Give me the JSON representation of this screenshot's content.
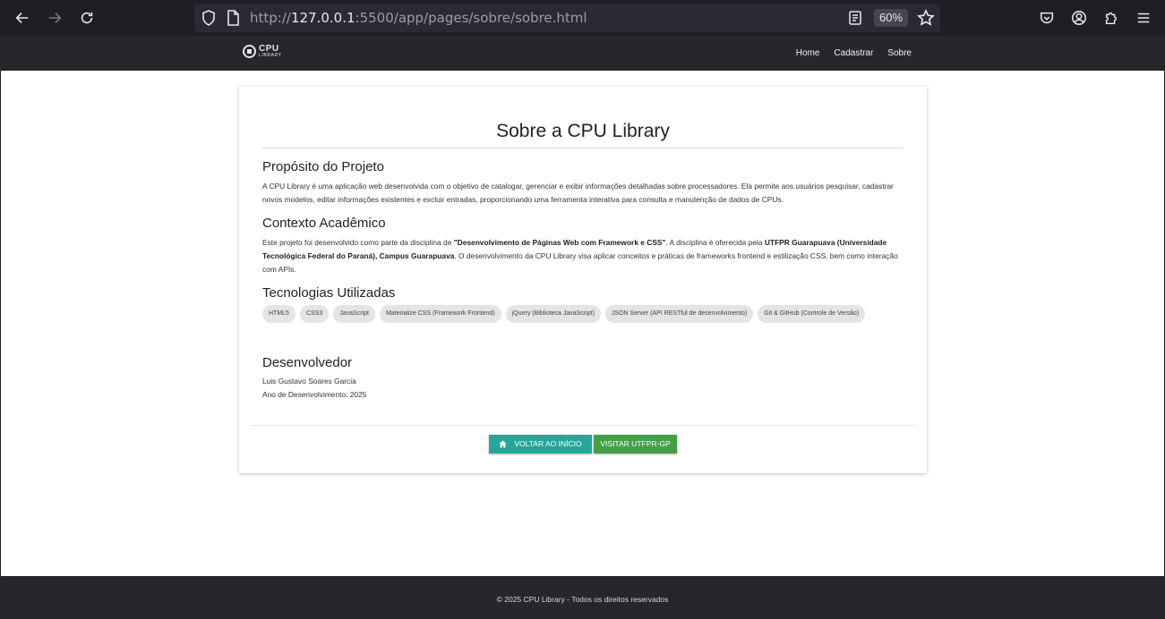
{
  "browser": {
    "url_prefix": "http://",
    "url_host": "127.0.0.1",
    "url_rest": ":5500/app/pages/sobre/sobre.html",
    "zoom": "60%"
  },
  "site": {
    "logo_line1": "CPU",
    "logo_line2": "LIBRARY",
    "nav": [
      "Home",
      "Cadastrar",
      "Sobre"
    ]
  },
  "card": {
    "title": "Sobre a CPU Library",
    "purpose_heading": "Propósito do Projeto",
    "purpose_text": "A CPU Library é uma aplicação web desenvolvida com o objetivo de catalogar, gerenciar e exibir informações detalhadas sobre processadores. Ela permite aos usuários pesquisar, cadastrar novos modelos, editar informações existentes e excluir entradas, proporcionando uma ferramenta interativa para consulta e manutenção de dados de CPUs.",
    "context_heading": "Contexto Acadêmico",
    "context_p1": "Este projeto foi desenvolvido como parte da disciplina de ",
    "context_b1": "\"Desenvolvimento de Páginas Web com Framework e CSS\"",
    "context_p2": ". A disciplina é oferecida pela ",
    "context_b2": "UTFPR Guarapuava (Universidade Tecnológica Federal do Paraná), Campus Guarapuava",
    "context_p3": ". O desenvolvimento da CPU Library visa aplicar conceitos e práticas de frameworks frontend e estilização CSS, bem como interação com APIs.",
    "tech_heading": "Tecnologias Utilizadas",
    "techs": [
      "HTML5",
      "CSS3",
      "JavaScript",
      "Materialize CSS (Framework Frontend)",
      "jQuery (Biblioteca JavaScript)",
      "JSON Server (API RESTful de desenvolvimento)",
      "Git & GitHub (Controle de Versão)"
    ],
    "dev_heading": "Desenvolvedor",
    "dev_name": "Luis Gustavo Soares Garcia",
    "dev_year": "Ano de Desenvolvimento: 2025",
    "btn_home": "VOLTAR AO INÍCIO",
    "btn_utfpr": "VISITAR UTFPR-GP"
  },
  "footer": {
    "text": "© 2025 CPU Library - Todos os direitos reservados"
  },
  "colors": {
    "teal": "#26a69a",
    "green": "#43a047",
    "navbar": "#25272b"
  }
}
